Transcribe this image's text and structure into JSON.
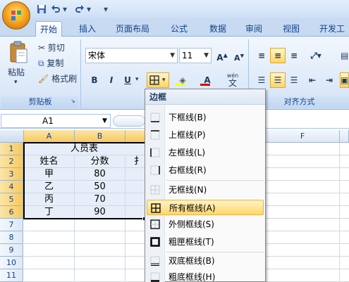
{
  "quick_access": {
    "save": "save-icon",
    "undo": "undo-icon",
    "redo": "redo-icon",
    "customize": "▾"
  },
  "tabs": [
    "开始",
    "插入",
    "页面布局",
    "公式",
    "数据",
    "审阅",
    "视图",
    "开发工具"
  ],
  "clipboard": {
    "paste": "粘贴",
    "cut": "剪切",
    "copy": "复制",
    "format_painter": "格式刷",
    "group_label": "剪贴板"
  },
  "font": {
    "name": "宋体",
    "size": "11",
    "bold": "B",
    "italic": "I",
    "underline": "U",
    "phonetic": "wén",
    "phonetic_char": "文"
  },
  "alignment": {
    "group_label": "对齐方式"
  },
  "name_box": "A1",
  "columns": [
    "A",
    "B",
    "F"
  ],
  "rows": [
    "1",
    "2",
    "3",
    "4",
    "5",
    "6",
    "7",
    "8",
    "9",
    "10",
    "11"
  ],
  "cells": {
    "title": "人员表",
    "header": [
      "姓名",
      "分数"
    ],
    "c3_partial": "扌",
    "data": [
      [
        "甲",
        "80"
      ],
      [
        "乙",
        "50"
      ],
      [
        "丙",
        "70"
      ],
      [
        "丁",
        "90"
      ]
    ]
  },
  "menu": {
    "title": "边框",
    "items": [
      "下框线(B)",
      "上框线(P)",
      "左框线(L)",
      "右框线(R)",
      "无框线(N)",
      "所有框线(A)",
      "外侧框线(S)",
      "粗匣框线(T)",
      "双底框线(B)",
      "粗底框线(H)"
    ]
  }
}
